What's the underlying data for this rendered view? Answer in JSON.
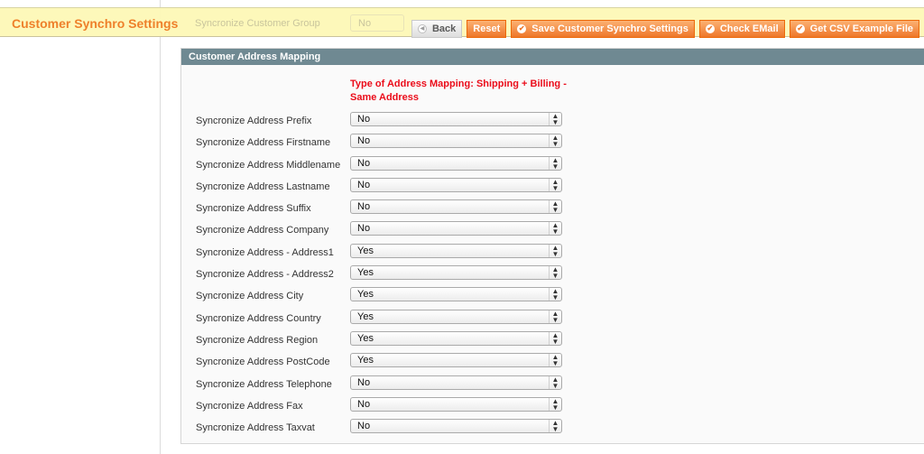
{
  "header": {
    "title": "Customer Synchro Settings",
    "ghost_label": "Syncronize Customer Group",
    "ghost_value": "No",
    "buttons": {
      "back": "Back",
      "reset": "Reset",
      "save": "Save Customer Synchro Settings",
      "check_email": "Check EMail",
      "get_csv": "Get CSV Example File"
    }
  },
  "panel": {
    "title": "Customer Address Mapping",
    "mapping_type": "Type of Address Mapping: Shipping + Billing - Same Address",
    "rows": [
      {
        "label": "Syncronize Address Prefix",
        "value": "No"
      },
      {
        "label": "Syncronize Address Firstname",
        "value": "No"
      },
      {
        "label": "Syncronize Address Middlename",
        "value": "No"
      },
      {
        "label": "Syncronize Address Lastname",
        "value": "No"
      },
      {
        "label": "Syncronize Address Suffix",
        "value": "No"
      },
      {
        "label": "Syncronize Address Company",
        "value": "No"
      },
      {
        "label": "Syncronize Address - Address1",
        "value": "Yes"
      },
      {
        "label": "Syncronize Address - Address2",
        "value": "Yes"
      },
      {
        "label": "Syncronize Address City",
        "value": "Yes"
      },
      {
        "label": "Syncronize Address Country",
        "value": "Yes"
      },
      {
        "label": "Syncronize Address Region",
        "value": "Yes"
      },
      {
        "label": "Syncronize Address PostCode",
        "value": "Yes"
      },
      {
        "label": "Syncronize Address Telephone",
        "value": "No"
      },
      {
        "label": "Syncronize Address Fax",
        "value": "No"
      },
      {
        "label": "Syncronize Address Taxvat",
        "value": "No"
      }
    ]
  }
}
